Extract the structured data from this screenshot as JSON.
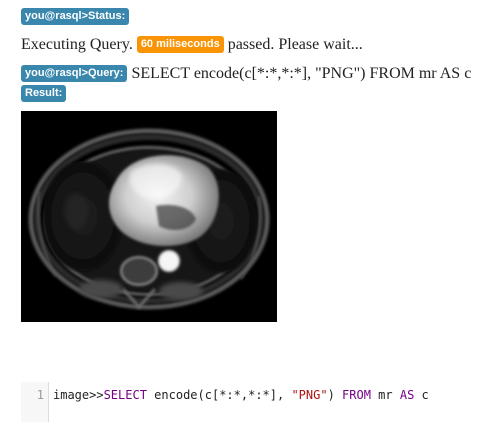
{
  "status": {
    "prompt_label": "you@rasql>Status:"
  },
  "execution": {
    "prefix": "Executing Query.",
    "duration_badge": "60 miliseconds",
    "suffix": "passed. Please wait..."
  },
  "query": {
    "prompt_label": "you@rasql>Query:",
    "text": "SELECT encode(c[*:*,*:*], \"PNG\") FROM mr AS c"
  },
  "result": {
    "label": "Result:",
    "image_icon": "mri-cardiac-slice-image"
  },
  "editor": {
    "line_number": "1",
    "prefix": "image>>",
    "tokens": {
      "select": "SELECT",
      "space1": " ",
      "encode": "encode",
      "args_open": "(c[*:*,*:*], ",
      "png": "\"PNG\"",
      "args_close": ") ",
      "from": "FROM",
      "mr": " mr ",
      "as": "AS",
      "c": " c"
    }
  },
  "colors": {
    "info_badge": "#3a87ad",
    "warning_badge": "#f89406",
    "keyword": "#770088",
    "string": "#aa1111"
  }
}
